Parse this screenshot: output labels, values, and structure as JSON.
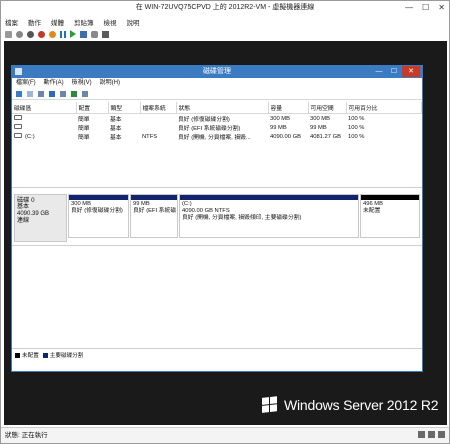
{
  "window": {
    "title": "在 WIN-72UVQ75CPVD 上的 2012R2-VM - 虛擬機器連線",
    "menu": [
      "檔案",
      "動作",
      "媒體",
      "剪貼簿",
      "檢視",
      "說明"
    ],
    "min": "—",
    "max": "☐",
    "close": "✕"
  },
  "mmc": {
    "title": "磁碟管理",
    "menu": [
      "檔案(F)",
      "動作(A)",
      "檢視(V)",
      "說明(H)"
    ],
    "columns": [
      "磁碟區",
      "配置",
      "類型",
      "檔案系統",
      "狀態",
      "容量",
      "可用空間",
      "可用百分比"
    ],
    "rows": [
      {
        "vol": "",
        "layout": "簡單",
        "type": "基本",
        "fs": "",
        "status": "良好 (修復磁碟分割)",
        "cap": "300 MB",
        "free": "300 MB",
        "pct": "100 %"
      },
      {
        "vol": "",
        "layout": "簡單",
        "type": "基本",
        "fs": "",
        "status": "良好 (EFI 系統磁碟分割)",
        "cap": "99 MB",
        "free": "99 MB",
        "pct": "100 %"
      },
      {
        "vol": "(C:)",
        "layout": "簡單",
        "type": "基本",
        "fs": "NTFS",
        "status": "良好 (開機, 分頁檔案, 損毀...",
        "cap": "4090.00 GB",
        "free": "4081.27 GB",
        "pct": "100 %"
      }
    ],
    "disk": {
      "name": "磁碟 0",
      "type": "基本",
      "size": "4090.39 GB",
      "state": "連線",
      "parts": [
        {
          "l1": "",
          "l2": "300 MB",
          "l3": "良好 (修復磁碟分割)",
          "unalloc": false
        },
        {
          "l1": "",
          "l2": "99 MB",
          "l3": "良好 (EFI 系統磁",
          "unalloc": false
        },
        {
          "l1": "(C:)",
          "l2": "4090.00 GB NTFS",
          "l3": "良好 (開機, 分頁檔案, 損毀傾印, 主要磁碟分割)",
          "unalloc": false
        },
        {
          "l1": "",
          "l2": "496 MB",
          "l3": "未配置",
          "unalloc": true
        }
      ]
    },
    "legend": [
      "未配置",
      "主要磁碟分割"
    ]
  },
  "brand": "Windows Server 2012 R2",
  "status": "狀態: 正在執行",
  "colors": {
    "accent": "#3a7bc2",
    "primary_partition": "#13246e",
    "unallocated": "#000000"
  }
}
